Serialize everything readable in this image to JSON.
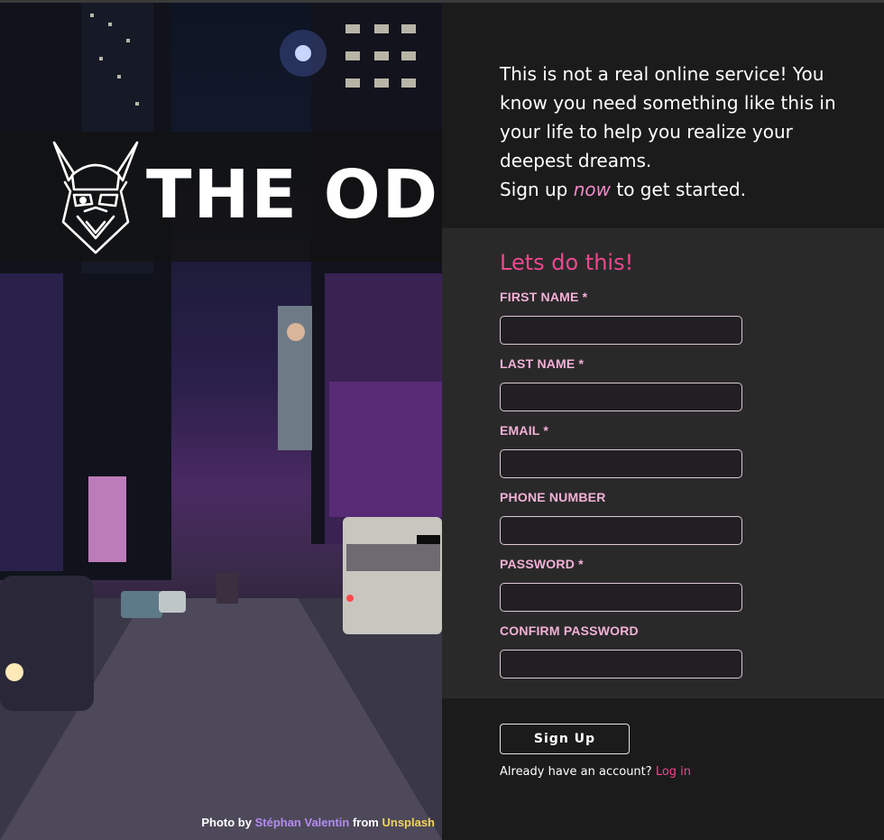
{
  "brand": {
    "wordmark": "THE ODIN",
    "logo_icon": "viking-helmet-icon"
  },
  "photo_credit": {
    "prefix": "Photo by",
    "photographer": "Stéphan Valentin",
    "middle": "from",
    "site": "Unsplash"
  },
  "intro": {
    "line": "This is not a real online service! You know you need something like this in your life to help you realize your deepest dreams.",
    "signup_prefix": "Sign up",
    "signup_emphasis": "now",
    "signup_suffix": "to get started."
  },
  "form": {
    "heading": "Lets do this!",
    "fields": [
      {
        "label": "FIRST NAME *",
        "value": "",
        "placeholder": ""
      },
      {
        "label": "LAST NAME *",
        "value": "",
        "placeholder": ""
      },
      {
        "label": "EMAIL *",
        "value": "",
        "placeholder": ""
      },
      {
        "label": "PHONE NUMBER",
        "value": "",
        "placeholder": ""
      },
      {
        "label": "PASSWORD *",
        "value": "",
        "placeholder": ""
      },
      {
        "label": "CONFIRM PASSWORD",
        "value": "",
        "placeholder": ""
      }
    ]
  },
  "actions": {
    "signup_label": "Sign Up",
    "have_account": "Already have an account?",
    "login_label": "Log in"
  },
  "colors": {
    "page_bg": "#1b1b1b",
    "form_bg": "#2a292a",
    "accent_pink": "#f0478f",
    "label_pink": "#f3b1d7",
    "emphasis_pink": "#f289c7",
    "credit_purple": "#b48cf0",
    "credit_yellow": "#f0d45a"
  }
}
